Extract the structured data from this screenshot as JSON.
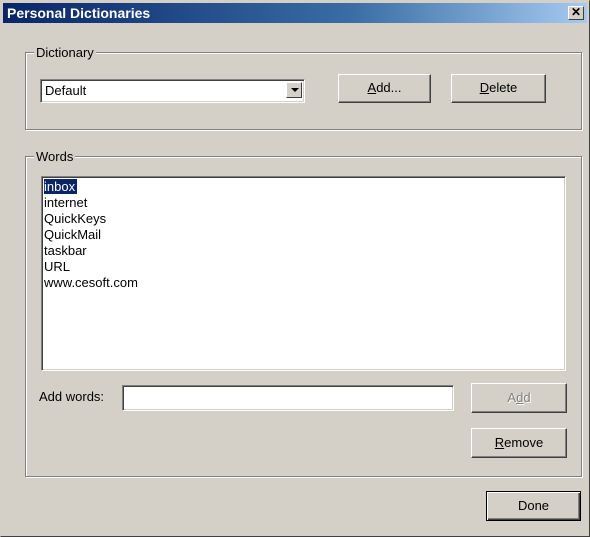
{
  "window": {
    "title": "Personal Dictionaries"
  },
  "dictionary_group": {
    "legend": "Dictionary",
    "selected": "Default",
    "add_label_pre": "",
    "add_label_key": "A",
    "add_label_post": "dd...",
    "delete_label_key": "D",
    "delete_label_post": "elete"
  },
  "words_group": {
    "legend": "Words",
    "words": [
      "inbox",
      "internet",
      "QuickKeys",
      "QuickMail",
      "taskbar",
      "URL",
      "www.cesoft.com"
    ],
    "selected_index": 0,
    "add_words_label": "Add words:",
    "add_words_value": "",
    "add_button_pre": "A",
    "add_button_key": "d",
    "add_button_post": "d",
    "remove_key": "R",
    "remove_post": "emove"
  },
  "done_label": "Done"
}
